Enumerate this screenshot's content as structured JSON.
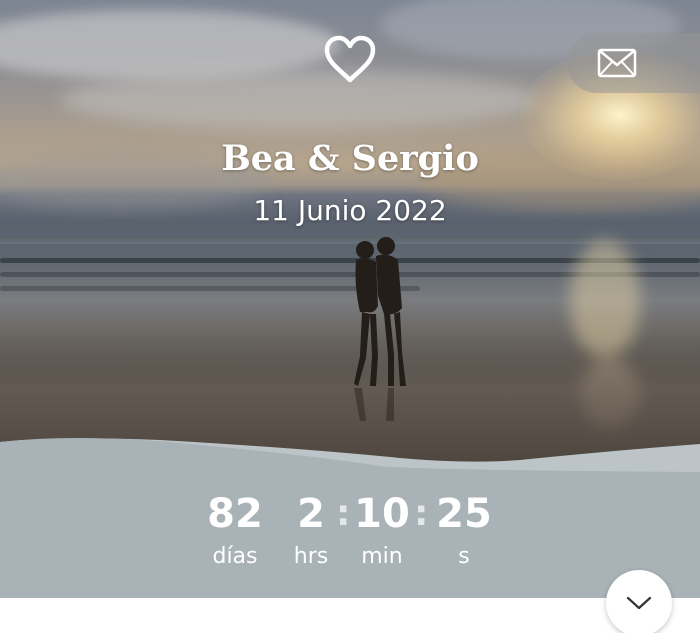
{
  "header": {
    "heart_icon": "heart-icon",
    "envelope_icon": "envelope-icon"
  },
  "couple": {
    "names": "Bea & Sergio",
    "date": "11 Junio 2022"
  },
  "countdown": {
    "days": {
      "value": "82",
      "label": "días"
    },
    "hours": {
      "value": "2",
      "label": "hrs"
    },
    "minutes": {
      "value": "10",
      "label": "min"
    },
    "seconds": {
      "value": "25",
      "label": "s"
    },
    "separator": ":"
  },
  "scroll_button": {
    "icon": "chevron-down-icon"
  },
  "colors": {
    "panel": "#a9b2b6",
    "panel_light": "#bcc4c7",
    "text": "#ffffff"
  }
}
